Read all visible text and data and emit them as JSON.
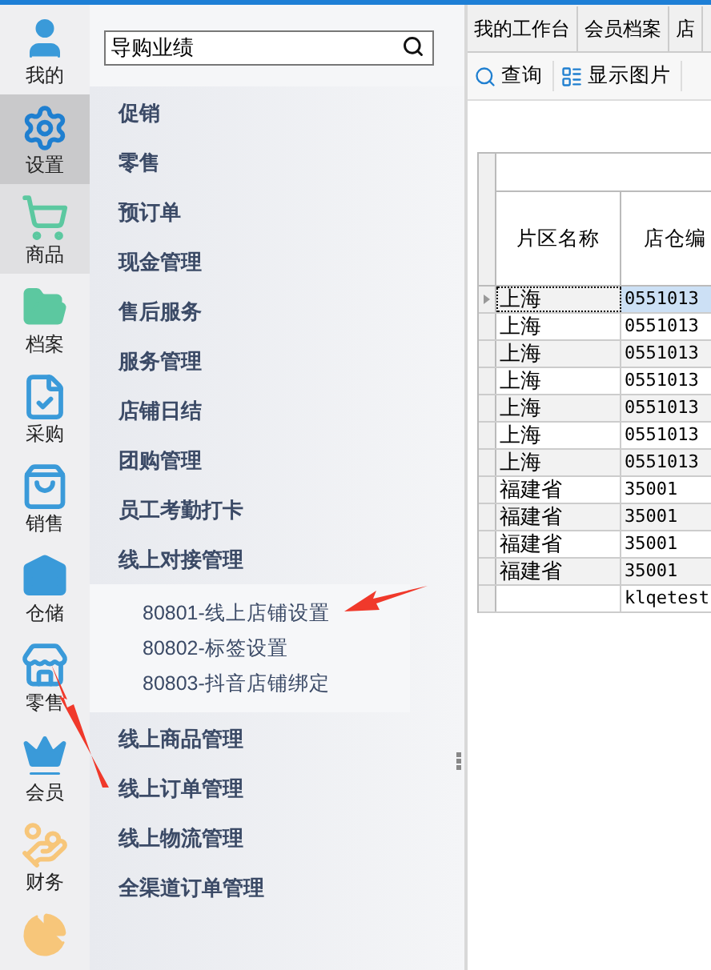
{
  "nav": [
    {
      "label": "我的",
      "selected": false,
      "hovered": false
    },
    {
      "label": "设置",
      "selected": true,
      "hovered": false
    },
    {
      "label": "商品",
      "selected": false,
      "hovered": true
    },
    {
      "label": "档案",
      "selected": false,
      "hovered": false
    },
    {
      "label": "采购",
      "selected": false,
      "hovered": false
    },
    {
      "label": "销售",
      "selected": false,
      "hovered": false
    },
    {
      "label": "仓储",
      "selected": false,
      "hovered": false
    },
    {
      "label": "零售",
      "selected": false,
      "hovered": false
    },
    {
      "label": "会员",
      "selected": false,
      "hovered": false
    },
    {
      "label": "财务",
      "selected": false,
      "hovered": false
    }
  ],
  "menu": {
    "search": {
      "value": "导购业绩"
    },
    "items": [
      {
        "label": "促销"
      },
      {
        "label": "零售"
      },
      {
        "label": "预订单"
      },
      {
        "label": "现金管理"
      },
      {
        "label": "售后服务"
      },
      {
        "label": "服务管理"
      },
      {
        "label": "店铺日结"
      },
      {
        "label": "团购管理"
      },
      {
        "label": "员工考勤打卡"
      },
      {
        "label": "线上对接管理",
        "expanded": true,
        "children": [
          {
            "label": "80801-线上店铺设置"
          },
          {
            "label": "80802-标签设置"
          },
          {
            "label": "80803-抖音店铺绑定"
          }
        ]
      },
      {
        "label": "线上商品管理"
      },
      {
        "label": "线上订单管理"
      },
      {
        "label": "线上物流管理"
      },
      {
        "label": "全渠道订单管理"
      }
    ]
  },
  "tabs": [
    {
      "label": "我的工作台",
      "selected": false
    },
    {
      "label": "会员档案",
      "selected": false
    },
    {
      "label": "店",
      "selected": false
    }
  ],
  "toolbar": [
    "查询",
    "显示图片"
  ],
  "table": {
    "columns": [
      "片区名称",
      "店仓编"
    ],
    "rows": [
      {
        "cells": [
          "上海",
          "0551013"
        ],
        "selected": true
      },
      {
        "cells": [
          "上海",
          "0551013"
        ],
        "selected": false
      },
      {
        "cells": [
          "上海",
          "0551013"
        ],
        "selected": false
      },
      {
        "cells": [
          "上海",
          "0551013"
        ],
        "selected": false
      },
      {
        "cells": [
          "上海",
          "0551013"
        ],
        "selected": false
      },
      {
        "cells": [
          "上海",
          "0551013"
        ],
        "selected": false
      },
      {
        "cells": [
          "上海",
          "0551013"
        ],
        "selected": false
      },
      {
        "cells": [
          "福建省",
          "35001"
        ],
        "selected": false
      },
      {
        "cells": [
          "福建省",
          "35001"
        ],
        "selected": false
      },
      {
        "cells": [
          "福建省",
          "35001"
        ],
        "selected": false
      },
      {
        "cells": [
          "福建省",
          "35001"
        ],
        "selected": false
      },
      {
        "cells": [
          "",
          "klqetest"
        ],
        "selected": false
      }
    ]
  }
}
